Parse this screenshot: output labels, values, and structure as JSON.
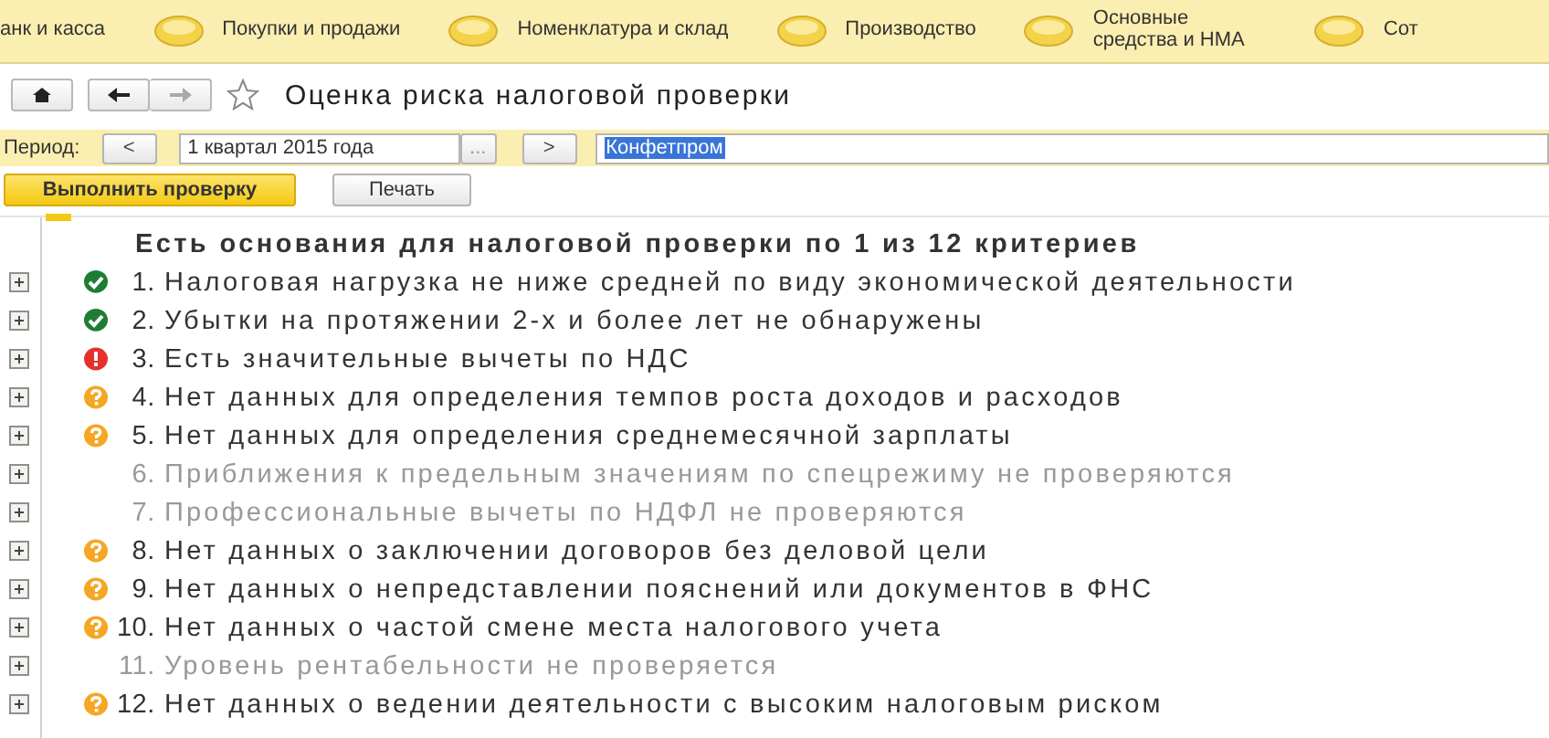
{
  "sections": [
    {
      "label": "анк и касса"
    },
    {
      "label": "Покупки и продажи"
    },
    {
      "label": "Номенклатура и склад"
    },
    {
      "label": "Производство"
    },
    {
      "label": "Основные средства и НМА"
    },
    {
      "label": "Сот"
    }
  ],
  "title": "Оценка риска налоговой проверки",
  "period": {
    "label": "Период:",
    "prev": "<",
    "value": "1 квартал 2015 года",
    "choose": "...",
    "next": ">",
    "organization": "Конфетпром"
  },
  "buttons": [
    {
      "label": "Выполнить проверку",
      "kind": "primary"
    },
    {
      "label": "Печать",
      "kind": "plain"
    }
  ],
  "heading": "Есть основания для налоговой проверки по 1 из 12 критериев",
  "criteria": [
    {
      "number": "1.",
      "text": "Налоговая нагрузка не ниже средней по виду экономической деятельности",
      "kind": "ok",
      "expanded": false
    },
    {
      "number": "2.",
      "text": "Убытки на протяжении 2-х и более лет не обнаружены",
      "kind": "ok",
      "expanded": false
    },
    {
      "number": "3.",
      "text": "Есть значительные вычеты по НДС",
      "kind": "risk",
      "expanded": false
    },
    {
      "number": "4.",
      "text": "Нет данных для определения темпов роста доходов и расходов",
      "kind": "unknown",
      "expanded": false
    },
    {
      "number": "5.",
      "text": "Нет данных для определения среднемесячной зарплаты",
      "kind": "unknown",
      "expanded": false
    },
    {
      "number": "6.",
      "text": "Приближения к предельным значениям по спецрежиму не проверяются",
      "kind": "skipped",
      "expanded": false
    },
    {
      "number": "7.",
      "text": "Профессиональные вычеты по НДФЛ не проверяются",
      "kind": "skipped",
      "expanded": false
    },
    {
      "number": "8.",
      "text": "Нет данных о заключении договоров без деловой цели",
      "kind": "unknown",
      "expanded": false
    },
    {
      "number": "9.",
      "text": "Нет данных о непредставлении пояснений или документов в ФНС",
      "kind": "unknown",
      "expanded": false
    },
    {
      "number": "10.",
      "text": "Нет данных о частой смене места налогового учета",
      "kind": "unknown",
      "expanded": false
    },
    {
      "number": "11.",
      "text": "Уровень рентабельности не проверяется",
      "kind": "skipped",
      "expanded": false
    },
    {
      "number": "12.",
      "text": "Нет данных о ведении деятельности с высоким налоговым риском",
      "kind": "unknown",
      "expanded": false
    }
  ]
}
